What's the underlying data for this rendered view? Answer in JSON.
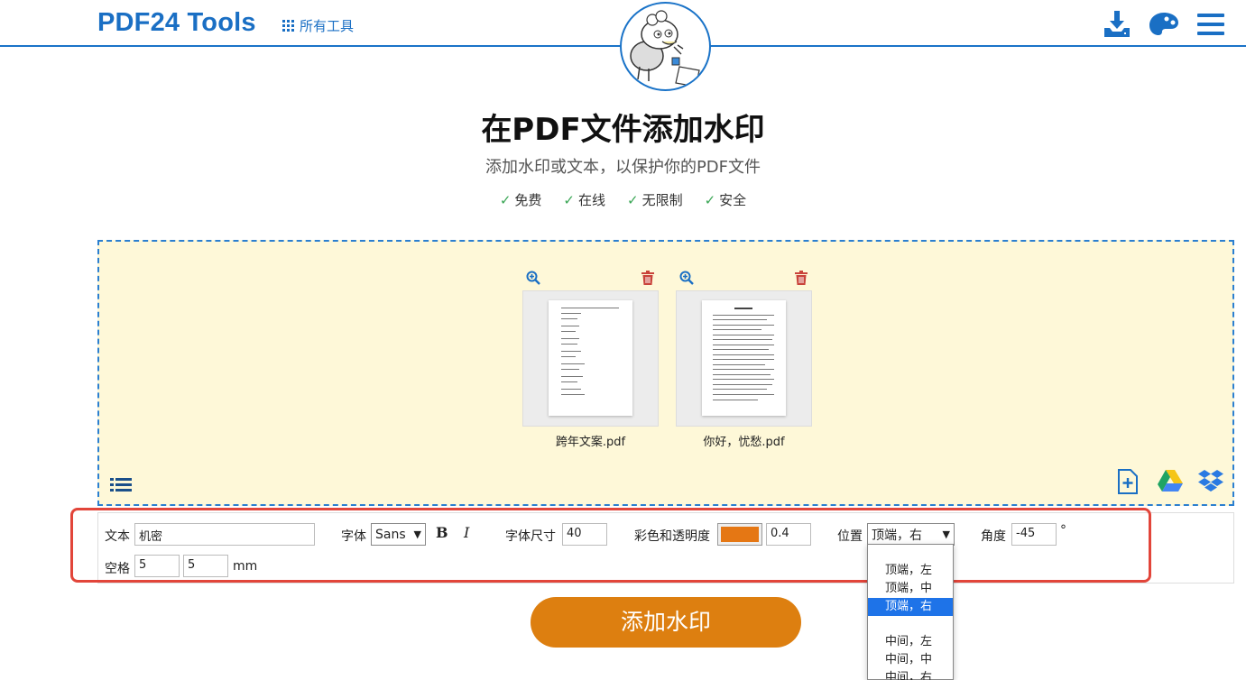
{
  "header": {
    "brand": "PDF24 Tools",
    "all_tools": "所有工具",
    "icons": [
      "download-icon",
      "palette-icon",
      "hamburger-menu-icon"
    ]
  },
  "hero": {
    "title": "在PDF文件添加水印",
    "subtitle": "添加水印或文本，以保护你的PDF文件",
    "features": [
      "免费",
      "在线",
      "无限制",
      "安全"
    ]
  },
  "files": [
    {
      "name": "跨年文案.pdf"
    },
    {
      "name": "你好，忧愁.pdf"
    }
  ],
  "dropzone_icons": [
    "list-view-icon",
    "add-file-icon",
    "google-drive-icon",
    "dropbox-icon"
  ],
  "options": {
    "text_label": "文本",
    "text_value": "机密",
    "font_label": "字体",
    "font_value": "Sans",
    "bold_label": "B",
    "italic_label": "I",
    "size_label": "字体尺寸",
    "size_value": "40",
    "color_label": "彩色和透明度",
    "color_hex": "#e57714",
    "opacity_value": "0.4",
    "position_label": "位置",
    "position_value": "顶端，右",
    "angle_label": "角度",
    "angle_value": "-45",
    "angle_unit": "°",
    "spacing_label": "空格",
    "spacing_x": "5",
    "spacing_y": "5",
    "spacing_unit": "mm"
  },
  "position_dropdown": {
    "options_top": [
      "顶端，左",
      "顶端，中",
      "顶端，右"
    ],
    "options_middle": [
      "中间，左",
      "中间，中",
      "中间，右"
    ],
    "selected": "顶端，右"
  },
  "submit_label": "添加水印",
  "colors": {
    "brand_blue": "#1a6fc4",
    "accent_orange": "#dd7f10",
    "dropzone_bg": "#fef8d8",
    "highlight_red": "#e2453a",
    "selected_blue": "#1e73e8"
  }
}
